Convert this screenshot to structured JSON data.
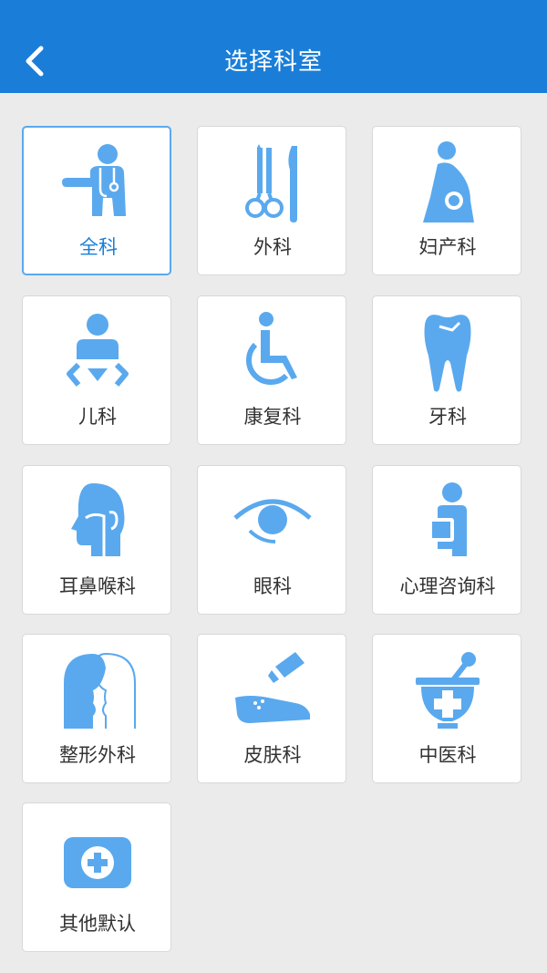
{
  "header": {
    "title": "选择科室",
    "back_icon": "chevron-left-icon"
  },
  "colors": {
    "header_bg": "#1a7ed8",
    "icon": "#5aa9ee",
    "selected_border": "#5aa9ee",
    "page_bg": "#ebebeb"
  },
  "departments": [
    {
      "label": "全科",
      "icon": "general-doctor-icon",
      "selected": true
    },
    {
      "label": "外科",
      "icon": "surgery-tools-icon",
      "selected": false
    },
    {
      "label": "妇产科",
      "icon": "pregnant-icon",
      "selected": false
    },
    {
      "label": "儿科",
      "icon": "baby-icon",
      "selected": false
    },
    {
      "label": "康复科",
      "icon": "wheelchair-icon",
      "selected": false
    },
    {
      "label": "牙科",
      "icon": "tooth-icon",
      "selected": false
    },
    {
      "label": "耳鼻喉科",
      "icon": "ent-head-icon",
      "selected": false
    },
    {
      "label": "眼科",
      "icon": "eye-icon",
      "selected": false
    },
    {
      "label": "心理咨询科",
      "icon": "counseling-icon",
      "selected": false
    },
    {
      "label": "整形外科",
      "icon": "face-profile-icon",
      "selected": false
    },
    {
      "label": "皮肤科",
      "icon": "ointment-hand-icon",
      "selected": false
    },
    {
      "label": "中医科",
      "icon": "mortar-pestle-icon",
      "selected": false
    },
    {
      "label": "其他默认",
      "icon": "first-aid-kit-icon",
      "selected": false
    }
  ]
}
